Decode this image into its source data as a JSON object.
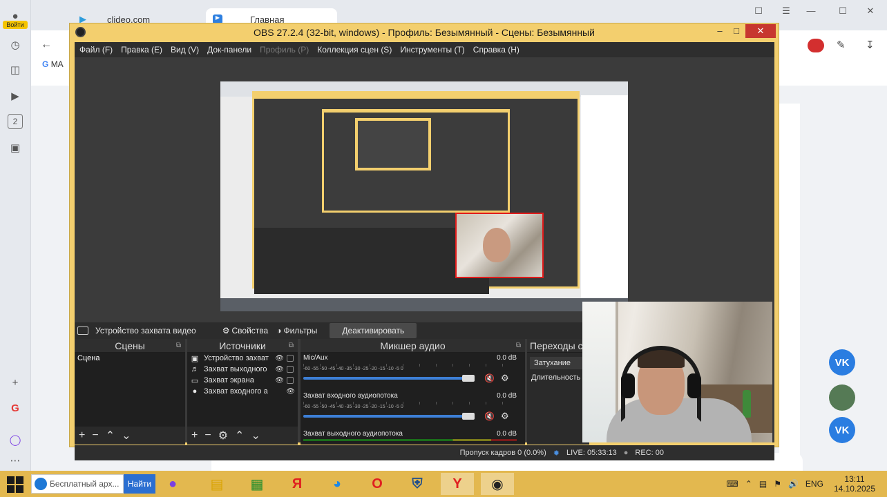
{
  "browser": {
    "login_label": "Войти",
    "tabs": [
      "clideo.com",
      "Главная"
    ],
    "bookmark_fragment": "MA",
    "side_badge": "2"
  },
  "obs": {
    "title": "OBS 27.2.4 (32-bit, windows) - Профиль: Безымянный - Сцены: Безымянный",
    "menu": [
      "Файл (F)",
      "Правка (E)",
      "Вид (V)",
      "Док-панели",
      "Профиль (P)",
      "Коллекция сцен (S)",
      "Инструменты (T)",
      "Справка (H)"
    ],
    "source_bar": {
      "source_name": "Устройство захвата видео",
      "properties": "Свойства",
      "filters": "Фильтры",
      "deactivate": "Деактивировать"
    },
    "scenes": {
      "title": "Сцены",
      "items": [
        "Сцена"
      ]
    },
    "sources": {
      "title": "Источники",
      "items": [
        {
          "icon": "camera-icon",
          "label": "Устройство захват"
        },
        {
          "icon": "speaker-icon",
          "label": "Захват выходного"
        },
        {
          "icon": "monitor-icon",
          "label": "Захват экрана"
        },
        {
          "icon": "mic-icon",
          "label": "Захват входного а"
        }
      ]
    },
    "mixer": {
      "title": "Микшер аудио",
      "scale": "-60  -55  -50  -45  -40  -35  -30  -25  -20  -15  -10  -5  0",
      "channels": [
        {
          "name": "Mic/Aux",
          "db": "0.0 dB"
        },
        {
          "name": "Захват входного аудиопотока",
          "db": "0.0 dB"
        },
        {
          "name": "Захват выходного аудиопотока",
          "db": "0.0 dB"
        }
      ]
    },
    "transitions": {
      "title": "Переходы сц",
      "type": "Затухание",
      "duration": "Длительность"
    },
    "status": {
      "dropped": "Пропуск кадров 0 (0.0%)",
      "live": "LIVE: 05:33:13",
      "rec": "REC: 00"
    }
  },
  "taskbar": {
    "search_placeholder": "Бесплатный арх...",
    "search_button": "Найти",
    "lang": "ENG",
    "time": "13:11",
    "date": "14.10.2025"
  },
  "colors": {
    "obs_frame": "#f3cf6e",
    "taskbar": "#e3b84f",
    "close": "#c7372f",
    "vk": "#2a7de1"
  }
}
